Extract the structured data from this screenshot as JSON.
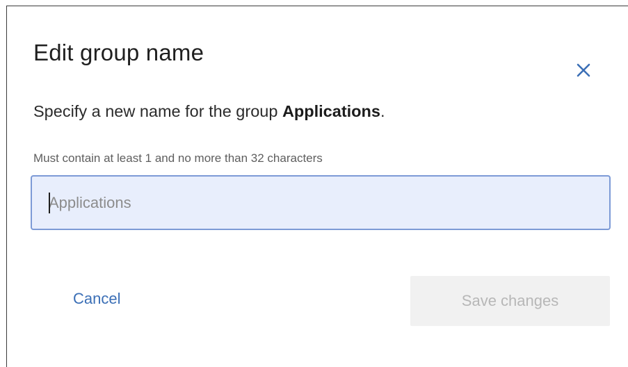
{
  "dialog": {
    "title": "Edit group name",
    "description_prefix": "Specify a new name for the group ",
    "group_name": "Applications",
    "description_suffix": ".",
    "hint": "Must contain at least 1 and no more than 32 characters",
    "input": {
      "value": "",
      "placeholder": "Applications"
    },
    "cancel_label": "Cancel",
    "save_label": "Save changes",
    "close_icon": "close-icon"
  },
  "colors": {
    "accent": "#3b6fb6",
    "input_focus_border": "#7c9ad6",
    "input_background": "#e8eefc",
    "disabled_button_bg": "#f1f1f1",
    "disabled_button_text": "#b7b7b7"
  }
}
